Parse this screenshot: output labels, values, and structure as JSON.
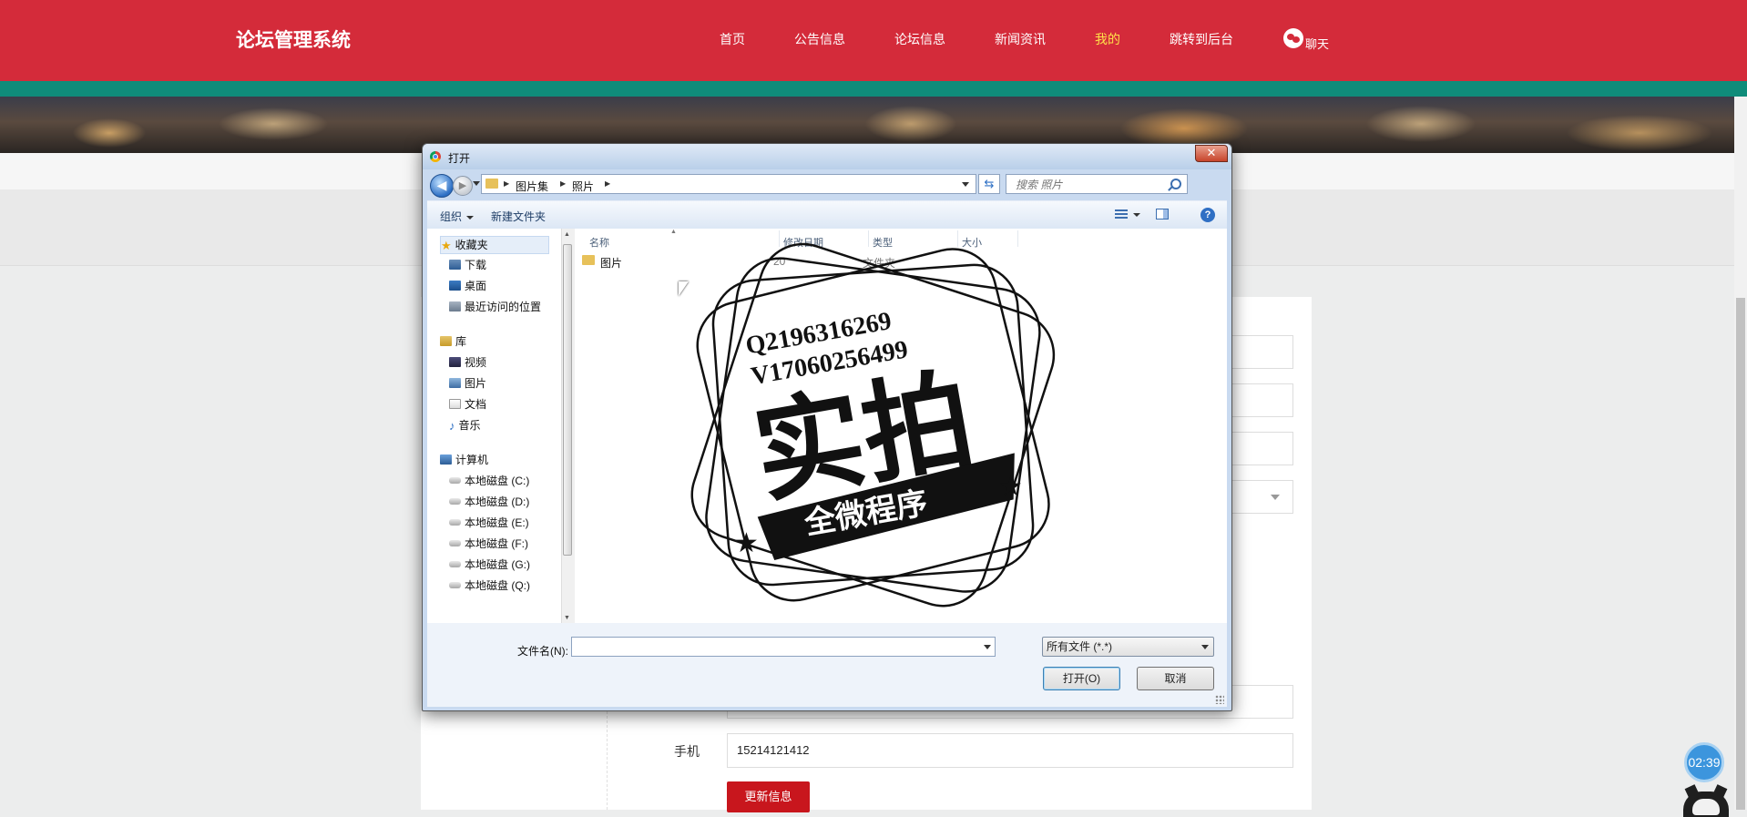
{
  "header": {
    "site_title": "论坛管理系统",
    "nav": [
      "首页",
      "公告信息",
      "论坛信息",
      "新闻资讯",
      "我的",
      "跳转到后台"
    ],
    "active_nav": "我的",
    "chat_label": "聊天"
  },
  "form": {
    "phone_label": "手机",
    "phone_value": "15214121412",
    "update_button": "更新信息"
  },
  "timer": "02:39",
  "dialog": {
    "title": "打开",
    "breadcrumb": [
      "图片集",
      "照片"
    ],
    "search_placeholder": "搜索 照片",
    "toolbar": {
      "organize": "组织",
      "new_folder": "新建文件夹"
    },
    "nav_tree": [
      {
        "label": "收藏夹",
        "icon": "star-icon",
        "level": 0
      },
      {
        "label": "下载",
        "icon": "downloads-icon",
        "level": 1
      },
      {
        "label": "桌面",
        "icon": "desktop-icon",
        "level": 1
      },
      {
        "label": "最近访问的位置",
        "icon": "recent-places-icon",
        "level": 1
      },
      {
        "label": "库",
        "icon": "library-icon",
        "level": 0
      },
      {
        "label": "视频",
        "icon": "video-icon",
        "level": 1
      },
      {
        "label": "图片",
        "icon": "pictures-icon",
        "level": 1
      },
      {
        "label": "文档",
        "icon": "documents-icon",
        "level": 1
      },
      {
        "label": "音乐",
        "icon": "music-icon",
        "level": 1
      },
      {
        "label": "计算机",
        "icon": "computer-icon",
        "level": 0
      },
      {
        "label": "本地磁盘 (C:)",
        "icon": "drive-c-icon",
        "level": 1
      },
      {
        "label": "本地磁盘 (D:)",
        "icon": "drive-icon",
        "level": 1
      },
      {
        "label": "本地磁盘 (E:)",
        "icon": "drive-icon",
        "level": 1
      },
      {
        "label": "本地磁盘 (F:)",
        "icon": "drive-icon",
        "level": 1
      },
      {
        "label": "本地磁盘 (G:)",
        "icon": "drive-icon",
        "level": 1
      },
      {
        "label": "本地磁盘 (Q:)",
        "icon": "drive-icon",
        "level": 1
      }
    ],
    "columns": [
      "名称",
      "修改日期",
      "类型",
      "大小"
    ],
    "files": [
      {
        "name": "图片",
        "date": "20",
        "type": "文件夹",
        "size": ""
      }
    ],
    "filename_label": "文件名(N):",
    "filename_value": "",
    "filter_value": "所有文件 (*.*)",
    "open_button": "打开(O)",
    "cancel_button": "取消"
  },
  "watermark": {
    "line1": "Q2196316269",
    "line2": "V17060256499",
    "main": "实拍",
    "banner": "全微程序"
  }
}
